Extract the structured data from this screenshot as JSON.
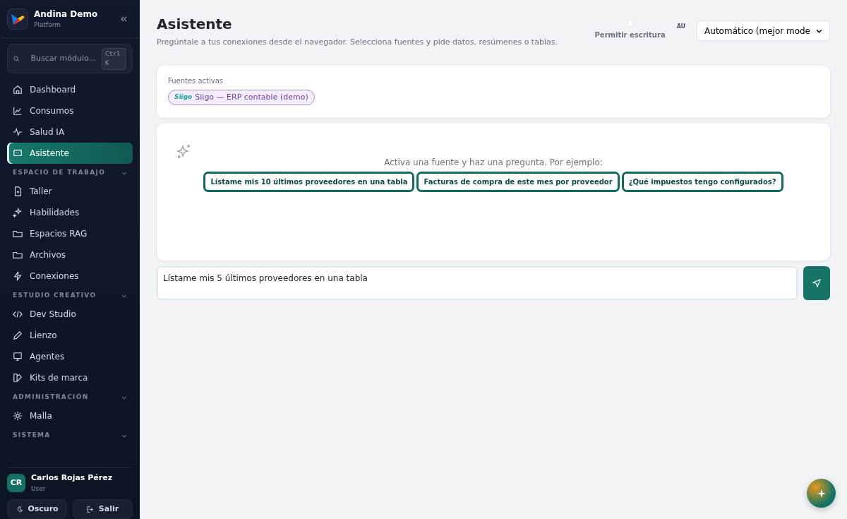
{
  "brand": {
    "name": "Andina Demo",
    "subtitle": "Platform"
  },
  "search": {
    "placeholder": "Buscar módulo...",
    "shortcut": "Ctrl K"
  },
  "nav": [
    {
      "label": "Dashboard",
      "selected": false
    },
    {
      "label": "Consumos",
      "selected": false
    },
    {
      "label": "Salud IA",
      "selected": false
    },
    {
      "label": "Asistente",
      "selected": true
    }
  ],
  "sections": [
    {
      "title": "ESPACIO DE TRABAJO",
      "items": [
        {
          "label": "Taller",
          "selected": false
        },
        {
          "label": "Habilidades",
          "selected": false
        },
        {
          "label": "Espacios RAG",
          "selected": false
        },
        {
          "label": "Archivos",
          "selected": false
        },
        {
          "label": "Conexiones",
          "selected": false
        }
      ]
    },
    {
      "title": "ESTUDIO CREATIVO",
      "items": [
        {
          "label": "Dev Studio",
          "selected": false
        },
        {
          "label": "Lienzo",
          "selected": false
        },
        {
          "label": "Agentes",
          "selected": false
        },
        {
          "label": "Kits de marca",
          "selected": false
        }
      ]
    },
    {
      "title": "ADMINISTRACIÓN",
      "items": [
        {
          "label": "Malla",
          "selected": false
        }
      ]
    },
    {
      "title": "SISTEMA"
    }
  ],
  "user": {
    "initials": "CR",
    "name": "Carlos Rojas Pérez",
    "role": "User"
  },
  "footer_buttons": [
    "Oscuro",
    "Salir"
  ],
  "page": {
    "title": "Asistente",
    "subtitle": "Pregúntale a tus conexiones desde el navegador. Selecciona fuentes y pide datos, resúmenes o tablas."
  },
  "write_toggle": {
    "label": "Permitir escritura",
    "checked": false
  },
  "model": {
    "badge": "AU",
    "value": "Automático (mejor mode"
  },
  "sources": {
    "title": "Fuentes activas",
    "chips": [
      {
        "logo": "Siigo",
        "label": "Siigo — ERP contable (demo)"
      }
    ]
  },
  "empty": {
    "prompt": "Activa una fuente y haz una pregunta. Por ejemplo:",
    "examples": [
      "Lístame mis 10 últimos proveedores en una tabla",
      "Facturas de compra de este mes por proveedor",
      "¿Qué impuestos tengo configurados?"
    ]
  },
  "composer": {
    "value": "Lístame mis 5 últimos proveedores en una tabla"
  }
}
